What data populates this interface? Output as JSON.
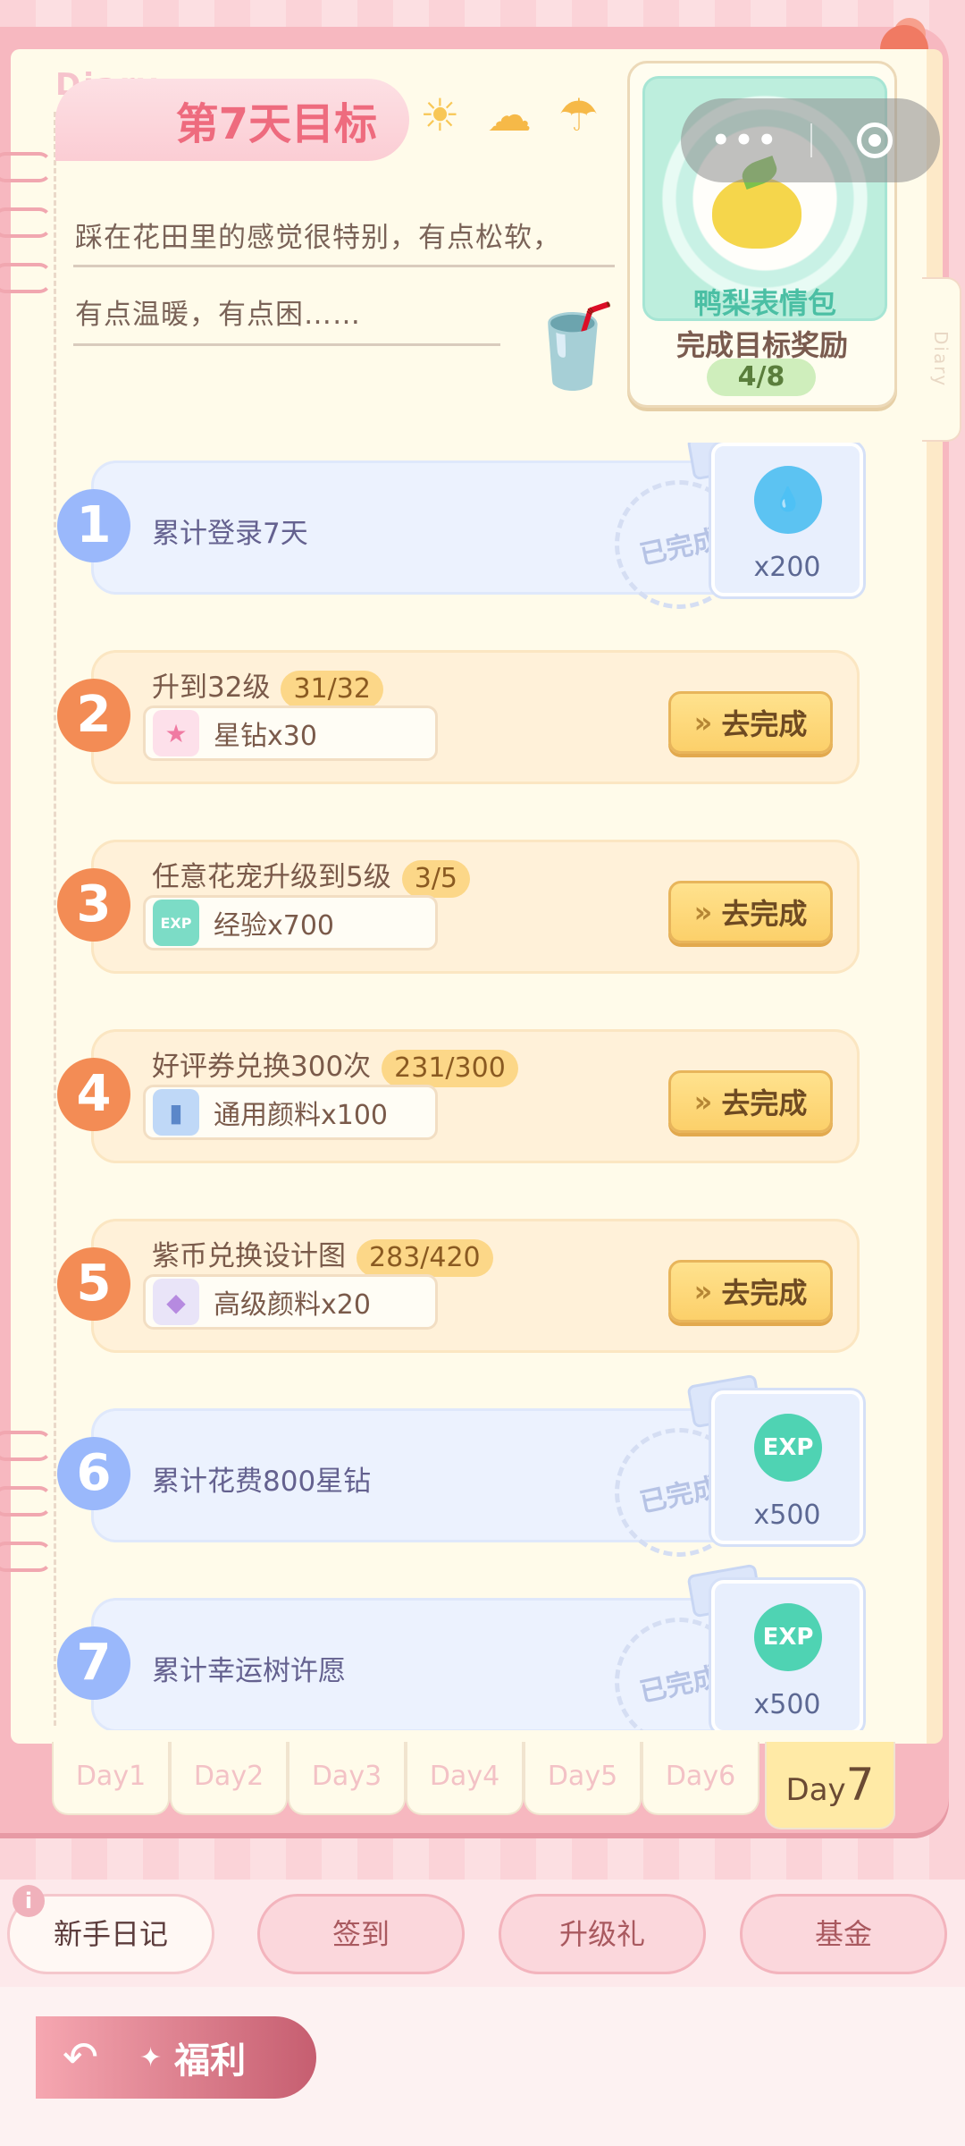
{
  "header": {
    "diary_label": "Diary",
    "title": "第7天目标",
    "weather_icons": [
      "sun-icon",
      "cloud-icon",
      "rain-cloud-icon"
    ],
    "diary_line1": "踩在花田里的感觉很特别，有点松软，",
    "diary_line2": "有点温暖，有点困……"
  },
  "side_tab_label": "Diary",
  "reward": {
    "name": "鸭梨表情包",
    "caption": "完成目标奖励",
    "progress": "4/8"
  },
  "capsule": {
    "more": "•••"
  },
  "tasks": [
    {
      "num": "1",
      "title": "累计登录7天",
      "status": "已完成",
      "item_qty": "x200",
      "item_icon": "water-drop-icon"
    },
    {
      "num": "2",
      "title": "升到32级",
      "progress": "31/32",
      "reward": "星钻x30",
      "reward_icon": "star-diamond-icon",
      "button": "去完成"
    },
    {
      "num": "3",
      "title": "任意花宠升级到5级",
      "progress": "3/5",
      "reward": "经验x700",
      "reward_icon": "exp-icon",
      "button": "去完成"
    },
    {
      "num": "4",
      "title": "好评券兑换300次",
      "progress": "231/300",
      "reward": "通用颜料x100",
      "reward_icon": "paint-bottle-icon",
      "button": "去完成"
    },
    {
      "num": "5",
      "title": "紫币兑换设计图",
      "progress": "283/420",
      "reward": "高级颜料x20",
      "reward_icon": "palette-icon",
      "button": "去完成"
    },
    {
      "num": "6",
      "title": "累计花费800星钻",
      "status": "已完成",
      "item_qty": "x500",
      "item_icon": "exp-badge-icon",
      "item_label": "EXP"
    },
    {
      "num": "7",
      "title": "累计幸运树许愿",
      "status": "已完成",
      "item_qty": "x500",
      "item_icon": "exp-badge-icon",
      "item_label": "EXP"
    }
  ],
  "days": {
    "items": [
      "Day1",
      "Day2",
      "Day3",
      "Day4",
      "Day5",
      "Day6"
    ],
    "active_prefix": "Day",
    "active_num": "7"
  },
  "bottom_nav": {
    "info": "i",
    "tabs": [
      "新手日记",
      "签到",
      "升级礼",
      "基金"
    ],
    "active_index": 0
  },
  "welfare": {
    "back": "↶",
    "sparkle": "✦",
    "label": "福利"
  },
  "colors": {
    "accent_pink": "#ee6b7e",
    "done_blue": "#9ab8fb",
    "todo_orange": "#f38c55",
    "button_yellow": "#fcd06a"
  }
}
